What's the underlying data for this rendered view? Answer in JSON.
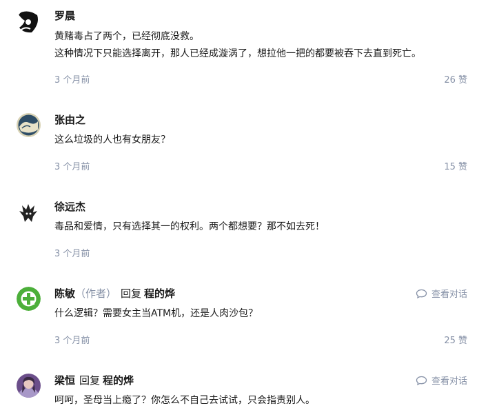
{
  "comments": [
    {
      "author": "罗晨",
      "lines": [
        "黄赌毒占了两个，已经彻底没救。",
        "这种情况下只能选择离开，那人已经成漩涡了，想拉他一把的都要被吞下去直到死亡。"
      ],
      "time": "3 个月前",
      "likes": "26 赞"
    },
    {
      "author": "张由之",
      "lines": [
        "这么垃圾的人也有女朋友？"
      ],
      "time": "3 个月前",
      "likes": "15 赞"
    },
    {
      "author": "徐远杰",
      "lines": [
        "毒品和爱情，只有选择其一的权利。两个都想要？那不如去死！"
      ],
      "time": "3 个月前",
      "likes": ""
    },
    {
      "author": "陈敏",
      "author_tag": "（作者）",
      "reply_label": "回复",
      "reply_to": "程的烨",
      "view_conversation": "查看对话",
      "lines": [
        "什么逻辑？需要女主当ATM机，还是人肉沙包？"
      ],
      "time": "3 个月前",
      "likes": "25 赞"
    },
    {
      "author": "梁恒",
      "reply_label": "回复",
      "reply_to": "程的烨",
      "view_conversation": "查看对话",
      "lines": [
        "呵呵，圣母当上瘾了？你怎么不自己去试试，只会指责别人。"
      ],
      "time": "",
      "likes": ""
    }
  ],
  "colors": {
    "text": "#1a1a1a",
    "muted": "#8590a6",
    "green_avatar": "#4caf3a"
  },
  "icons": {
    "conversation": "chat-bubble-icon"
  }
}
